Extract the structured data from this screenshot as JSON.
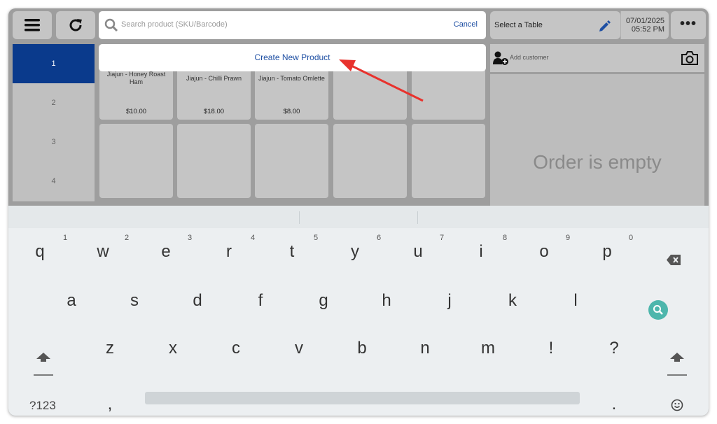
{
  "search": {
    "placeholder": "Search product (SKU/Barcode)",
    "cancel": "Cancel"
  },
  "table": {
    "label": "Select a Table"
  },
  "datetime": {
    "date": "07/01/2025",
    "time": "05:52 PM"
  },
  "create_new": "Create New Product",
  "categories": [
    "1",
    "2",
    "3",
    "4"
  ],
  "products": [
    {
      "name": "Jiajun - Honey Roast Ham",
      "price": "$10.00"
    },
    {
      "name": "Jiajun - Chilli Prawn",
      "price": "$18.00"
    },
    {
      "name": "Jiajun - Tomato Omlette",
      "price": "$8.00"
    }
  ],
  "customer": {
    "add_label": "Add customer"
  },
  "order": {
    "empty_text": "Order is empty"
  },
  "keyboard": {
    "row1": [
      "q",
      "w",
      "e",
      "r",
      "t",
      "y",
      "u",
      "i",
      "o",
      "p"
    ],
    "row1_hints": [
      "1",
      "2",
      "3",
      "4",
      "5",
      "6",
      "7",
      "8",
      "9",
      "0"
    ],
    "row2": [
      "a",
      "s",
      "d",
      "f",
      "g",
      "h",
      "j",
      "k",
      "l"
    ],
    "row3": [
      "z",
      "x",
      "c",
      "v",
      "b",
      "n",
      "m",
      "!",
      "?"
    ],
    "mode_key": "?123",
    "comma": ",",
    "period": "."
  },
  "colors": {
    "accent": "#0a3a8c",
    "link": "#1e4fa3",
    "annotation_arrow": "#e8322d",
    "search_key": "#4db6ac"
  }
}
